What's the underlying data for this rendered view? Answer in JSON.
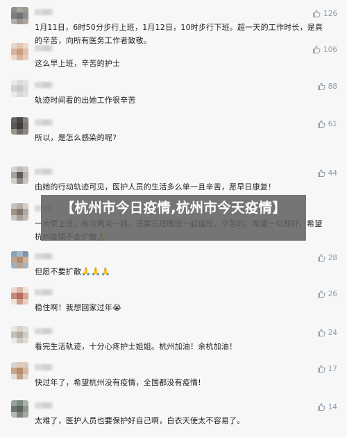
{
  "comments": [
    {
      "text": "1月11日，6时50分步行上班，1月12日，10时步行下班。超一天的工作时长，是真的辛苦，向所有医务工作者致敬。",
      "likes": "126",
      "avatar_colors": [
        "#8a8f8c",
        "#a7a39a",
        "#9c9a95",
        "#7b7f80",
        "#6e7173",
        "#8c8d8a",
        "#b4b0a8",
        "#9a958e",
        "#a9a59f"
      ]
    },
    {
      "text": "这么早上班，辛苦的护士",
      "likes": "106",
      "avatar_colors": [
        "#e6d6cb",
        "#e2c7b4",
        "#ead9cd",
        "#d9b39a",
        "#c99b7f",
        "#e0c2ad",
        "#ecd9ca",
        "#d8b59d",
        "#e4ccbb"
      ]
    },
    {
      "text": "轨迹时间看的出她工作很辛苦",
      "likes": "88",
      "avatar_colors": [
        "#e9e9e9",
        "#dcdcdc",
        "#e3e3e3",
        "#d2d2d2",
        "#c7c7c7",
        "#dadada",
        "#ececec",
        "#d8d8d8",
        "#e1e1e1"
      ]
    },
    {
      "text": "所以，是怎么感染的呢?",
      "likes": "61",
      "avatar_colors": [
        "#6a6660",
        "#4a4844",
        "#8a857c",
        "#5b5a56",
        "#3e3d3a",
        "#7e7a72",
        "#9a948a",
        "#6f6b64",
        "#8c877f"
      ]
    },
    {
      "text": "由她的行动轨迹可见，医护人员的生活多么单一且辛苦，愿早日康复！",
      "likes": "44",
      "avatar_colors": [
        "#d6d4cf",
        "#bfbcb6",
        "#cfcbc4",
        "#a8a49d",
        "#5c5a56",
        "#b9b5ae",
        "#d3d0ca",
        "#8f8b84",
        "#c8c4bd"
      ]
    },
    {
      "text": "一大早上班，每次两点一线，还要日班晚班一起值班，辛苦的，希望一切都好，希望杭州疫情不会扩散🙏",
      "likes": "",
      "avatar_colors": [
        "#c9c2ba",
        "#b8aea5",
        "#d4cec7",
        "#9e948a",
        "#7f766e",
        "#b2a89f",
        "#cdc6bf",
        "#a89e95",
        "#c2bab2"
      ]
    },
    {
      "text": "但愿不要扩散🙏🙏🙏",
      "likes": "28",
      "avatar_colors": [
        "#8aa3b8",
        "#a8b8c6",
        "#7d95aa",
        "#c0a38c",
        "#b08b70",
        "#c9b3a0",
        "#9fb0bf",
        "#b8a08a",
        "#a5b5c4"
      ]
    },
    {
      "text": "稳住啊！我想回家过年😭",
      "likes": "26",
      "avatar_colors": [
        "#ead9cf",
        "#d9b8a6",
        "#f0e2da",
        "#c9887a",
        "#b86c5c",
        "#d8a392",
        "#efe0d8",
        "#cf9d8d",
        "#e6cfc4"
      ]
    },
    {
      "text": "看完生活轨迹，十分心疼护士姐姐。杭州加油！余杭加油！",
      "likes": "24",
      "avatar_colors": [
        "#eae6e2",
        "#d8d2cc",
        "#e4dfda",
        "#c6bfb8",
        "#b3aba3",
        "#d2cbc4",
        "#ece8e4",
        "#cfc8c1",
        "#e0dad4"
      ]
    },
    {
      "text": "快过年了，希望杭州没有疫情，全国都没有疫情!",
      "likes": "17",
      "avatar_colors": [
        "#d9d5d0",
        "#e3c9b8",
        "#d2cdc7",
        "#caa58d",
        "#b98a6d",
        "#d6b7a2",
        "#e2ddd8",
        "#c79f86",
        "#dcd6d0"
      ]
    },
    {
      "text": "太难了，医护人员也要保护好自己啊，白衣天使太不容易了。",
      "likes": "14",
      "avatar_colors": [
        "#9aa39b",
        "#7f8a80",
        "#a9b1a9",
        "#6d776e",
        "#5c655d",
        "#8d968e",
        "#b2b9b2",
        "#7a837b",
        "#a0a8a1"
      ]
    }
  ],
  "overlay_title": "【杭州市今日疫情,杭州市今天疫情】"
}
